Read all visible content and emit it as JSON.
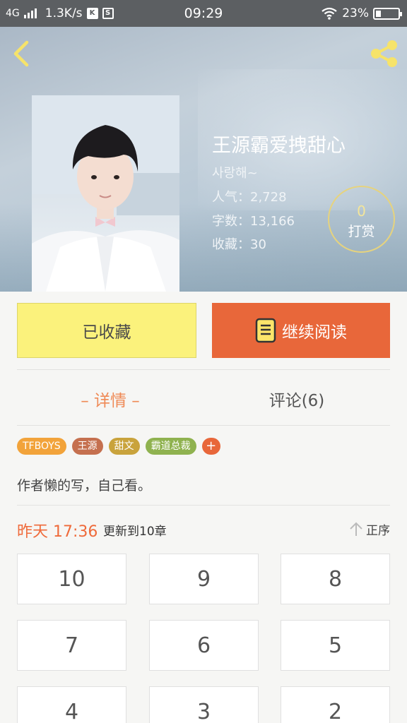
{
  "status_bar": {
    "network": "4G",
    "speed": "1.3K/s",
    "icon_k": "K",
    "icon_s": "S",
    "time": "09:29",
    "battery_pct": "23%",
    "battery_level": 0.23
  },
  "header": {
    "back_icon": "chevron-left-icon",
    "share_icon": "share-icon",
    "accent_color": "#f6e36a"
  },
  "book": {
    "title": "王源霸爱拽甜心",
    "author": "사랑해~",
    "popularity": "人气：2,728",
    "words": "字数：13,166",
    "favorites": "收藏：30"
  },
  "reward": {
    "count": "0",
    "label": "打赏"
  },
  "actions": {
    "favorite_label": "已收藏",
    "read_label": "继续阅读",
    "favorite_color": "#fbf27c",
    "read_color": "#e8673a"
  },
  "tabs": {
    "detail": "– 详情 –",
    "comments": "评论(6)"
  },
  "tags": [
    {
      "label": "TFBOYS",
      "color": "#f2a33a"
    },
    {
      "label": "王源",
      "color": "#c5704f"
    },
    {
      "label": "甜文",
      "color": "#c9a33c"
    },
    {
      "label": "霸道总裁",
      "color": "#8fb24f"
    },
    {
      "label": "+",
      "color": "#e8673a"
    }
  ],
  "description": "作者懒的写，自己看。",
  "update": {
    "time": "昨天 17:36",
    "text": "更新到10章",
    "sort_label": "正序",
    "sort_icon": "arrow-up-icon"
  },
  "chapters": [
    "10",
    "9",
    "8",
    "7",
    "6",
    "5",
    "4",
    "3",
    "2"
  ]
}
